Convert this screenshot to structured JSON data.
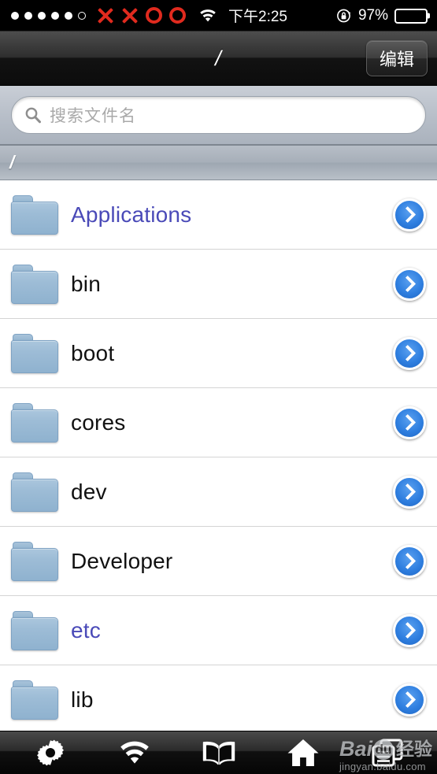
{
  "status_bar": {
    "signal_dots_filled": 5,
    "signal_dots_total": 6,
    "carrier_marks": [
      "x",
      "x",
      "o",
      "o"
    ],
    "wifi_icon": "wifi-icon",
    "time": "下午2:25",
    "rotation_lock_icon": "rotation-lock-icon",
    "battery_percent": "97%",
    "battery_icon": "battery-icon"
  },
  "nav_bar": {
    "title": "/",
    "edit_label": "编辑"
  },
  "search": {
    "placeholder": "搜索文件名",
    "value": "",
    "icon": "search-icon"
  },
  "section_header": {
    "label": "/"
  },
  "list": {
    "rows": [
      {
        "name": "Applications",
        "icon": "folder-icon",
        "accessory": "chevron-right-icon",
        "highlighted": true
      },
      {
        "name": "bin",
        "icon": "folder-icon",
        "accessory": "chevron-right-icon",
        "highlighted": false
      },
      {
        "name": "boot",
        "icon": "folder-icon",
        "accessory": "chevron-right-icon",
        "highlighted": false
      },
      {
        "name": "cores",
        "icon": "folder-icon",
        "accessory": "chevron-right-icon",
        "highlighted": false
      },
      {
        "name": "dev",
        "icon": "folder-icon",
        "accessory": "chevron-right-icon",
        "highlighted": false
      },
      {
        "name": "Developer",
        "icon": "folder-icon",
        "accessory": "chevron-right-icon",
        "highlighted": false
      },
      {
        "name": "etc",
        "icon": "folder-icon",
        "accessory": "chevron-right-icon",
        "highlighted": true
      },
      {
        "name": "lib",
        "icon": "folder-icon",
        "accessory": "chevron-right-icon",
        "highlighted": false
      }
    ]
  },
  "toolbar": {
    "items": [
      {
        "icon": "gear-icon"
      },
      {
        "icon": "wifi-icon"
      },
      {
        "icon": "book-icon"
      },
      {
        "icon": "home-icon"
      },
      {
        "icon": "windows-icon"
      }
    ]
  },
  "watermark": {
    "brand": "Bai",
    "badge": "du",
    "suffix": "经验",
    "url": "jingyan.baidu.com"
  },
  "colors": {
    "link": "#4a4ab8",
    "accessory_blue": "#2f7fe0",
    "carrier_red": "#e02a1e",
    "folder_blue": "#9dbcd6"
  }
}
